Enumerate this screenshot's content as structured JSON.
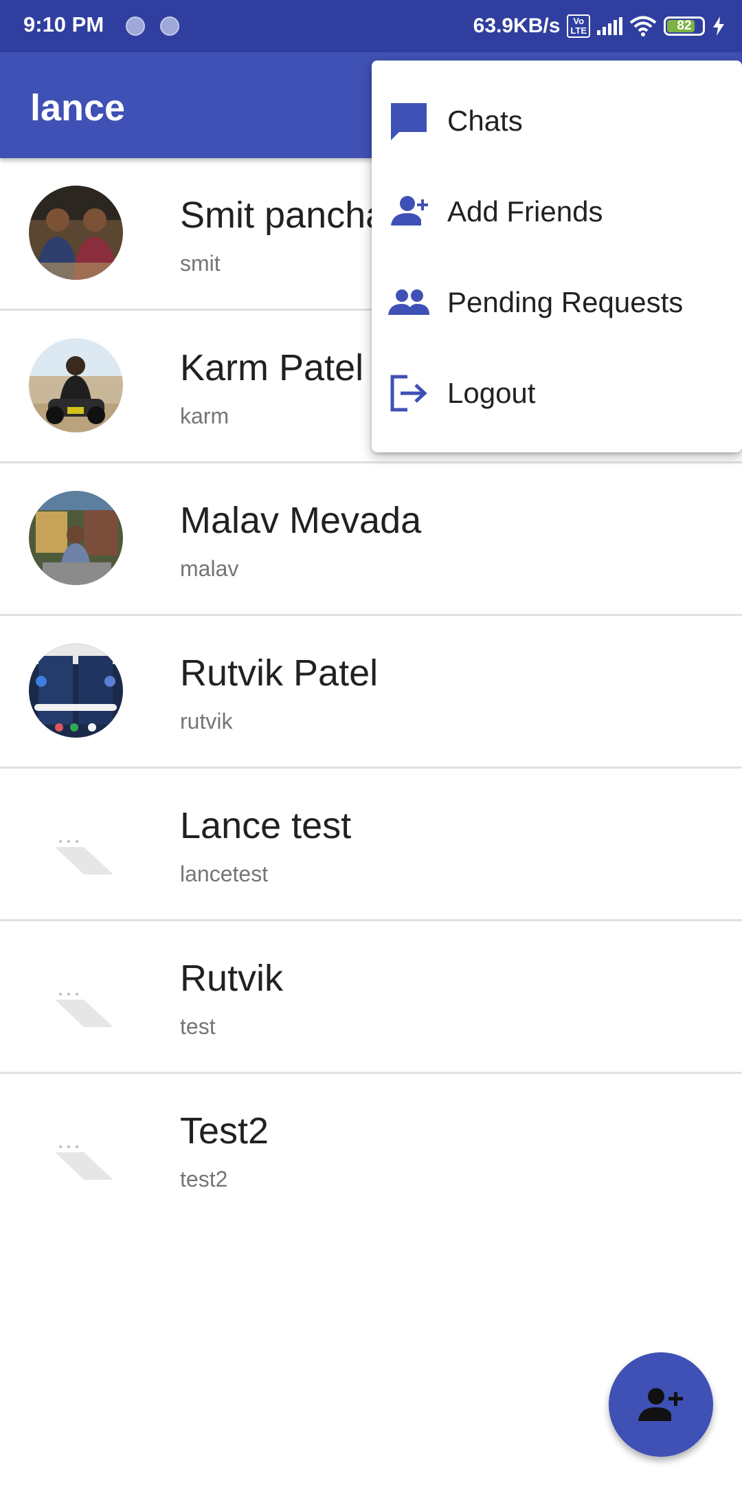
{
  "status_bar": {
    "time": "9:10 PM",
    "network_speed": "63.9KB/s",
    "volte_top": "Vo",
    "volte_bottom": "LTE",
    "battery_level": "82",
    "icons": [
      "notification-dot-icon",
      "notification-dot-icon",
      "volte-icon",
      "signal-icon",
      "wifi-icon",
      "battery-icon",
      "charging-bolt-icon"
    ]
  },
  "app_bar": {
    "title": "lance"
  },
  "contacts": [
    {
      "name": "Smit pancha",
      "username": "smit",
      "has_photo": true
    },
    {
      "name": "Karm Patel",
      "username": "karm",
      "has_photo": true
    },
    {
      "name": "Malav Mevada",
      "username": "malav",
      "has_photo": true
    },
    {
      "name": "Rutvik Patel",
      "username": "rutvik",
      "has_photo": true
    },
    {
      "name": "Lance test",
      "username": "lancetest",
      "has_photo": false
    },
    {
      "name": "Rutvik",
      "username": "test",
      "has_photo": false
    },
    {
      "name": "Test2",
      "username": "test2",
      "has_photo": false
    }
  ],
  "overflow_menu": {
    "items": [
      {
        "label": "Chats",
        "icon": "chat-icon"
      },
      {
        "label": "Add Friends",
        "icon": "person-add-icon"
      },
      {
        "label": "Pending Requests",
        "icon": "people-icon"
      },
      {
        "label": "Logout",
        "icon": "logout-icon"
      }
    ]
  },
  "fab": {
    "icon": "person-add-icon"
  },
  "colors": {
    "primary": "#3F51B5",
    "primary_dark": "#303F9F",
    "text_primary": "#212121",
    "text_secondary": "#757575",
    "divider": "#e0e0e0"
  }
}
